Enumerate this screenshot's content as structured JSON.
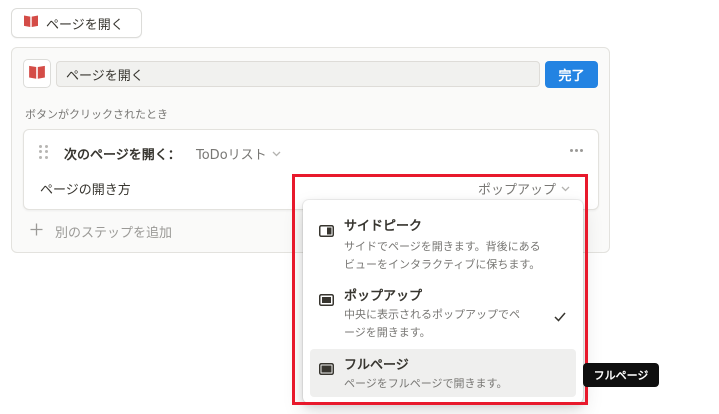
{
  "top_button": {
    "label": "ページを開く",
    "icon": "red-book-icon"
  },
  "editor": {
    "name_value": "ページを開く",
    "name_icon": "red-book-icon",
    "done_label": "完了",
    "trigger_label": "ボタンがクリックされたとき"
  },
  "step": {
    "title": "次のページを開く：",
    "target": "ToDoリスト",
    "open_mode_label": "ページの開き方",
    "open_mode_value": "ポップアップ"
  },
  "add_step_label": "別のステップを追加",
  "dropdown": {
    "options": [
      {
        "title": "サイドピーク",
        "desc_line1": "サイドでページを開きます。背後にある",
        "desc_line2": "ビューをインタラクティブに保ちます。",
        "icon": "side-peek-icon",
        "selected": false
      },
      {
        "title": "ポップアップ",
        "desc_line1": "中央に表示されるポップアップでペ",
        "desc_line2": "ージを開きます。",
        "icon": "popup-icon",
        "selected": true
      },
      {
        "title": "フルページ",
        "desc_line1": "ページをフルページで開きます。",
        "desc_line2": "",
        "icon": "full-page-icon",
        "selected": false,
        "hovered": true
      }
    ]
  },
  "tooltip": "フルページ",
  "colors": {
    "accent": "#2383e2",
    "highlight": "#e8192c",
    "book": "#d44c47"
  }
}
